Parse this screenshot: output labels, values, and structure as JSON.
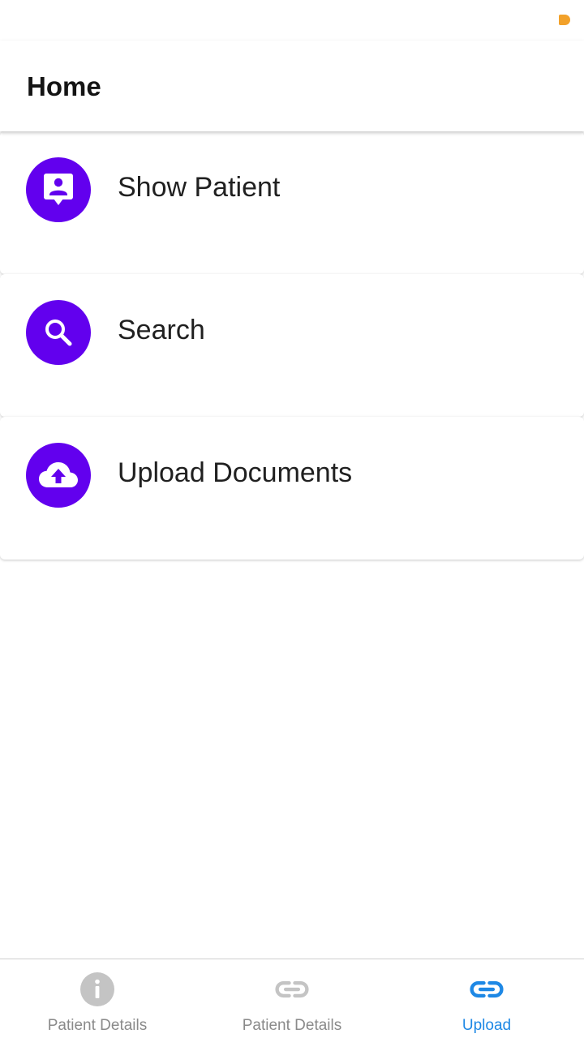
{
  "header": {
    "title": "Home"
  },
  "colors": {
    "accent": "#6200ee",
    "nav_active": "#1e88e5",
    "nav_inactive": "#c4c4c4",
    "status_indicator": "#f2a12a"
  },
  "menu": {
    "items": [
      {
        "label": "Show Patient",
        "icon": "patient-contact-icon"
      },
      {
        "label": "Search",
        "icon": "search-icon"
      },
      {
        "label": "Upload Documents",
        "icon": "cloud-upload-icon"
      }
    ]
  },
  "bottom_nav": {
    "tabs": [
      {
        "label": "Patient Details",
        "icon": "info-icon",
        "active": false
      },
      {
        "label": "Patient Details",
        "icon": "link-icon",
        "active": false
      },
      {
        "label": "Upload",
        "icon": "link-icon",
        "active": true
      }
    ]
  }
}
